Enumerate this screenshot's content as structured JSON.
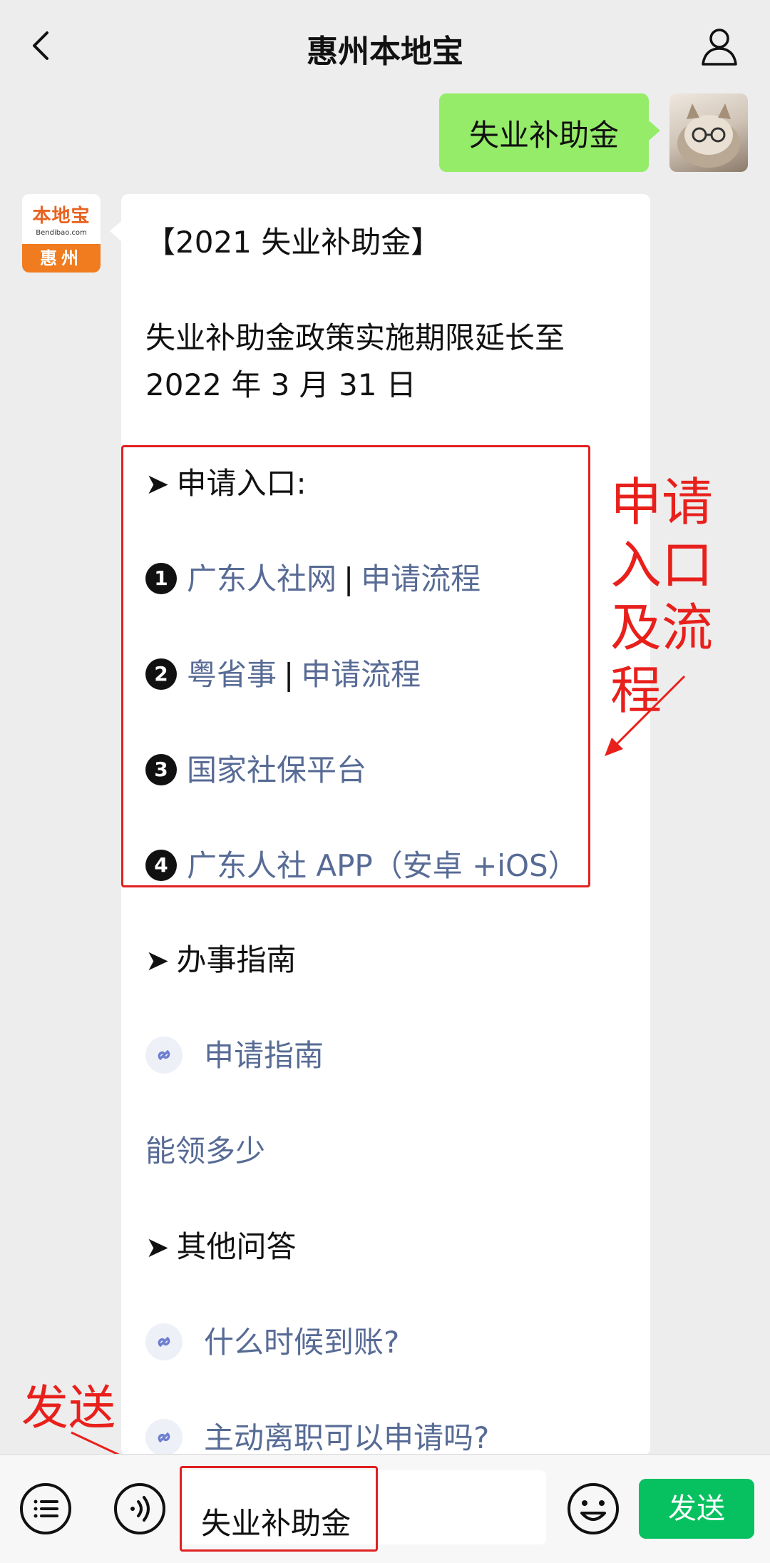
{
  "header": {
    "title": "惠州本地宝"
  },
  "sent_message": "失业补助金",
  "official_account": {
    "logo_text": "本地宝",
    "logo_url": "Bendibao.com",
    "city": "惠州"
  },
  "reply": {
    "title": "【2021 失业补助金】",
    "policy_line1": "失业补助金政策实施期限延长至",
    "policy_line2": "2022 年 3 月 31 日",
    "entry_heading": "申请入口:",
    "entries": [
      {
        "num": "1",
        "link": "广东人社网",
        "sep": "|",
        "link2": "申请流程"
      },
      {
        "num": "2",
        "link": "粤省事",
        "sep": "|",
        "link2": "申请流程"
      },
      {
        "num": "3",
        "link": "国家社保平台"
      },
      {
        "num": "4",
        "link": "广东人社 APP（安卓 +iOS）"
      }
    ],
    "guide_heading": "办事指南",
    "guide_link": "申请指南",
    "amount_link": "能领多少",
    "qa_heading": "其他问答",
    "qa_links": [
      "什么时候到账?",
      "主动离职可以申请吗?"
    ]
  },
  "annotations": {
    "entry_note": "申请入口及流程",
    "send_note": "发送"
  },
  "composer": {
    "input_value": "失业补助金",
    "send_label": "发送"
  },
  "colors": {
    "send_green": "#07c160",
    "bubble_green": "#95ec69",
    "link_blue": "#576b95",
    "annotation_red": "#e8201c"
  }
}
